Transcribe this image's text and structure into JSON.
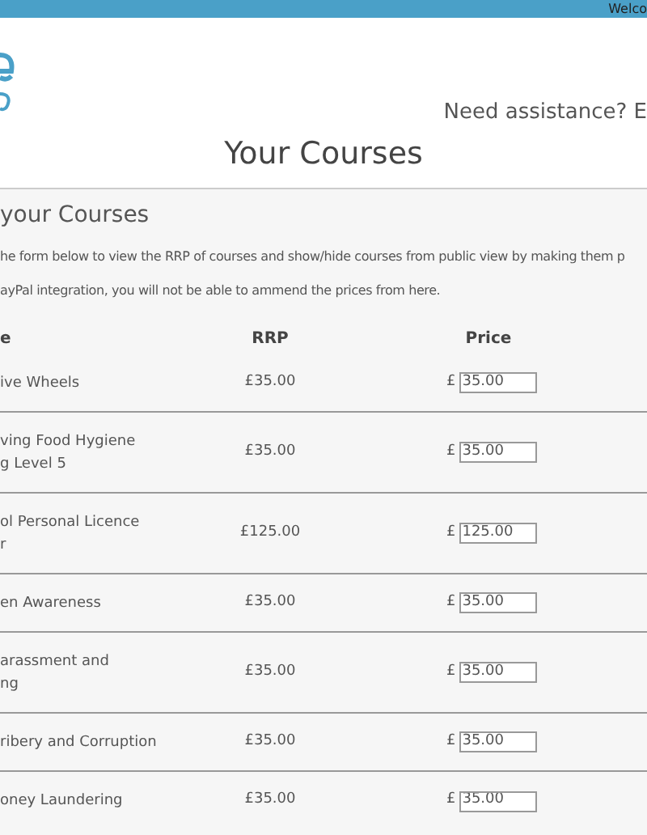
{
  "top_bar": {
    "welcome": "Welco"
  },
  "header": {
    "assistance": "Need assistance? E"
  },
  "page_title": "Your Courses",
  "section": {
    "title": "your Courses",
    "notes": [
      "he form below to view the RRP of courses and show/hide courses from public view by making them p",
      "ayPal integration, you will not be able to ammend the prices from here."
    ]
  },
  "table": {
    "columns": [
      "e",
      "RRP",
      "Price"
    ],
    "rows": [
      {
        "name_lines": [
          "ive Wheels"
        ],
        "rrp": "£35.00",
        "currency": "£",
        "price": "35.00"
      },
      {
        "name_lines": [
          "ving Food Hygiene",
          "g Level 5"
        ],
        "rrp": "£35.00",
        "currency": "£",
        "price": "35.00"
      },
      {
        "name_lines": [
          "ol Personal Licence",
          "r"
        ],
        "rrp": "£125.00",
        "currency": "£",
        "price": "125.00"
      },
      {
        "name_lines": [
          "en Awareness"
        ],
        "rrp": "£35.00",
        "currency": "£",
        "price": "35.00"
      },
      {
        "name_lines": [
          "arassment and",
          "ng"
        ],
        "rrp": "£35.00",
        "currency": "£",
        "price": "35.00"
      },
      {
        "name_lines": [
          "ribery and Corruption"
        ],
        "rrp": "£35.00",
        "currency": "£",
        "price": "35.00"
      },
      {
        "name_lines": [
          "oney Laundering"
        ],
        "rrp": "£35.00",
        "currency": "£",
        "price": "35.00"
      }
    ]
  }
}
